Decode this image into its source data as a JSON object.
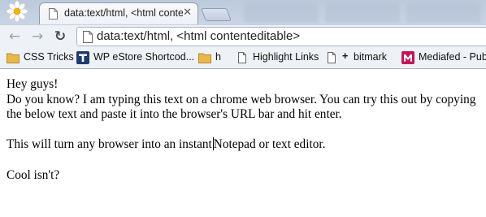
{
  "browser": {
    "tab": {
      "title": "data:text/html, <html contenteditable>"
    },
    "address_bar": {
      "value": "data:text/html, <html contenteditable>"
    },
    "bookmarks": [
      {
        "label": "CSS Tricks",
        "icon": "folder-icon"
      },
      {
        "label": "WP eStore Shortcod...",
        "icon": "t-logo-icon"
      },
      {
        "label": "h",
        "icon": "folder-icon"
      },
      {
        "label": "Highlight Links",
        "icon": "page-icon"
      },
      {
        "label": "bitmark",
        "icon": "plus-icon"
      },
      {
        "label": "Mediafed - Pub",
        "icon": "m-logo-icon"
      }
    ]
  },
  "page": {
    "line1": "Hey guys!",
    "line2": "Do you know? I am typing this text on a chrome web browser. You can try this out by copying the below text and paste it into the browser's URL bar and hit enter.",
    "line3_before_caret": "This will turn any browser into an instant",
    "line3_after_caret": "Notepad or text editor.",
    "line4": "Cool isn't?"
  },
  "colors": {
    "tabstrip": "#bcc9dc",
    "toolbar": "#eef1f5",
    "folder": "#e8b94a",
    "wp_logo": "#1e3a6e",
    "mediafed": "#c2185b"
  }
}
